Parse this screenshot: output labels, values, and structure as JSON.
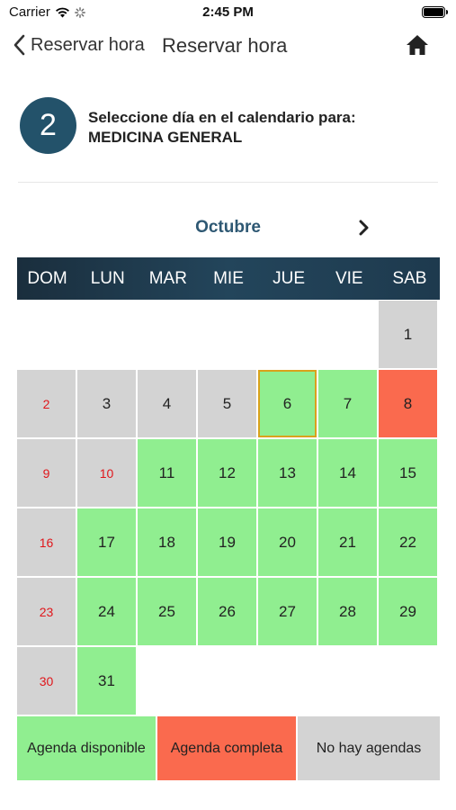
{
  "status_bar": {
    "carrier": "Carrier",
    "time": "2:45 PM"
  },
  "nav": {
    "back_label": "Reservar hora",
    "title": "Reservar hora"
  },
  "step": {
    "number": "2",
    "line1": "Seleccione día en el calendario para:",
    "line2": "MEDICINA GENERAL"
  },
  "calendar": {
    "month": "Octubre",
    "weekdays": [
      "DOM",
      "LUN",
      "MAR",
      "MIE",
      "JUE",
      "VIE",
      "SAB"
    ],
    "days": [
      {
        "label": "",
        "state": "empty"
      },
      {
        "label": "",
        "state": "empty"
      },
      {
        "label": "",
        "state": "empty"
      },
      {
        "label": "",
        "state": "empty"
      },
      {
        "label": "",
        "state": "empty"
      },
      {
        "label": "",
        "state": "empty"
      },
      {
        "label": "1",
        "state": "gray"
      },
      {
        "label": "2",
        "state": "gray",
        "red_text": true
      },
      {
        "label": "3",
        "state": "gray"
      },
      {
        "label": "4",
        "state": "gray"
      },
      {
        "label": "5",
        "state": "gray"
      },
      {
        "label": "6",
        "state": "green",
        "selected": true
      },
      {
        "label": "7",
        "state": "green"
      },
      {
        "label": "8",
        "state": "red"
      },
      {
        "label": "9",
        "state": "gray",
        "red_text": true
      },
      {
        "label": "10",
        "state": "gray",
        "red_text": true
      },
      {
        "label": "11",
        "state": "green"
      },
      {
        "label": "12",
        "state": "green"
      },
      {
        "label": "13",
        "state": "green"
      },
      {
        "label": "14",
        "state": "green"
      },
      {
        "label": "15",
        "state": "green"
      },
      {
        "label": "16",
        "state": "gray",
        "red_text": true
      },
      {
        "label": "17",
        "state": "green"
      },
      {
        "label": "18",
        "state": "green"
      },
      {
        "label": "19",
        "state": "green"
      },
      {
        "label": "20",
        "state": "green"
      },
      {
        "label": "21",
        "state": "green"
      },
      {
        "label": "22",
        "state": "green"
      },
      {
        "label": "23",
        "state": "gray",
        "red_text": true
      },
      {
        "label": "24",
        "state": "green"
      },
      {
        "label": "25",
        "state": "green"
      },
      {
        "label": "26",
        "state": "green"
      },
      {
        "label": "27",
        "state": "green"
      },
      {
        "label": "28",
        "state": "green"
      },
      {
        "label": "29",
        "state": "green"
      },
      {
        "label": "30",
        "state": "gray",
        "red_text": true
      },
      {
        "label": "31",
        "state": "green"
      }
    ]
  },
  "legend": {
    "available": "Agenda disponible",
    "full": "Agenda completa",
    "none": "No hay agendas"
  },
  "colors": {
    "accent": "#23526a",
    "available": "#90ee90",
    "full": "#fa6a4e",
    "none": "#d3d3d3",
    "selected_border": "#d9a21c",
    "holiday_text": "#e0161b"
  }
}
